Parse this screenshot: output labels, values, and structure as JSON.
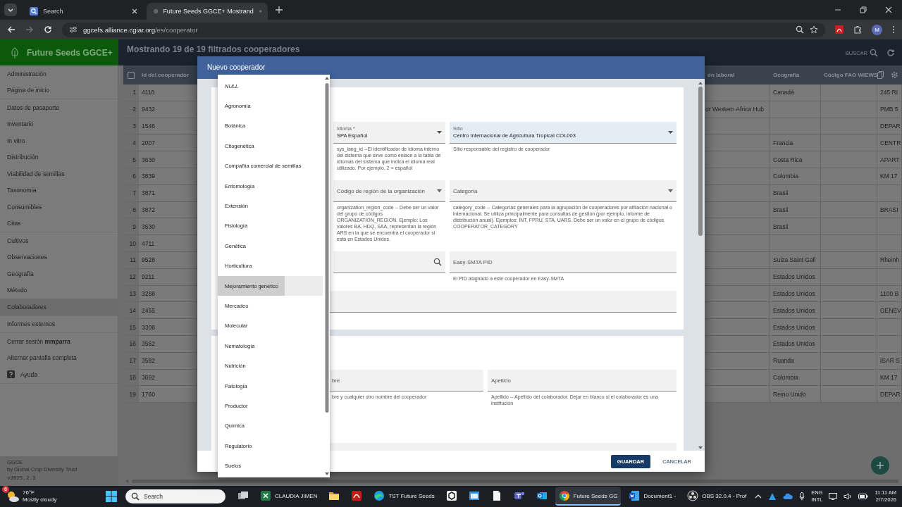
{
  "browser": {
    "tabs": [
      {
        "title": "Search",
        "selected": false
      },
      {
        "title": "Future Seeds GGCE+ Mostrand",
        "selected": true
      }
    ],
    "address": {
      "host": "ggcefs.alliance.cgiar.org",
      "path": "/es/cooperator"
    },
    "profile": "M"
  },
  "app": {
    "brand": "Future Seeds GGCE+",
    "heading": "Mostrando 19 de 19 filtrados cooperadores",
    "search_button": "BUSCAR"
  },
  "sidebar": {
    "groups": [
      [
        {
          "label": "Administración",
          "kind": "link",
          "selected": false
        },
        {
          "label": "Página de inicio",
          "kind": "link",
          "selected": false
        }
      ],
      [
        {
          "label": "Datos de pasaporte",
          "kind": "link",
          "selected": false
        },
        {
          "label": "Inventario",
          "kind": "link",
          "selected": false
        },
        {
          "label": "In vitro",
          "kind": "link",
          "selected": false
        },
        {
          "label": "Distribución",
          "kind": "link",
          "selected": false
        },
        {
          "label": "Viabilidad de semillas",
          "kind": "link",
          "selected": false
        },
        {
          "label": "Taxonomía",
          "kind": "link",
          "selected": false
        },
        {
          "label": "Consumibles",
          "kind": "link",
          "selected": false
        },
        {
          "label": "Citas",
          "kind": "link",
          "selected": false
        }
      ],
      [
        {
          "label": "Cultivos",
          "kind": "link",
          "selected": false
        },
        {
          "label": "Observaciones",
          "kind": "link",
          "selected": false
        },
        {
          "label": "Geografía",
          "kind": "link",
          "selected": false
        },
        {
          "label": "Método",
          "kind": "link",
          "selected": false
        },
        {
          "label": "Colaboradores",
          "kind": "link",
          "selected": true
        }
      ],
      [
        {
          "label": "Informes externos",
          "kind": "link",
          "selected": false
        }
      ],
      [
        {
          "label": "Cerrar sesión **mmparra**",
          "kind": "link",
          "selected": false
        },
        {
          "label": "Alternar pantalla completa",
          "kind": "link",
          "selected": false
        },
        {
          "label": "Ayuda",
          "kind": "help",
          "selected": false
        }
      ]
    ],
    "footer": {
      "product": "GGCE",
      "publisher": "by Global Crop Diversity Trust",
      "version": "v2025.2.3"
    }
  },
  "table": {
    "select_all": {
      "checked": false
    },
    "columns": [
      "Id del cooperador",
      "ón laboral",
      "Geografía",
      "Código FAO WIEWS"
    ],
    "rows": [
      {
        "number": "1",
        "id": "4118",
        "geography": "Canadá",
        "column_7": "245 RI"
      },
      {
        "number": "2",
        "id": "9432",
        "column_4": "or Western Africa Hub",
        "column_7": "PMB 5"
      },
      {
        "number": "3",
        "id": "1546",
        "column_7": "DEPAR"
      },
      {
        "number": "4",
        "id": "2007",
        "geography": "Francia",
        "column_7": "CENTR"
      },
      {
        "number": "5",
        "id": "3630",
        "geography": "Costa Rica",
        "column_7": "APART"
      },
      {
        "number": "6",
        "id": "3839",
        "geography": "Colombia",
        "column_7": "KM 17"
      },
      {
        "number": "7",
        "id": "3871",
        "geography": "Brasil"
      },
      {
        "number": "8",
        "id": "3872",
        "geography": "Brasil",
        "column_7": "BRASI"
      },
      {
        "number": "9",
        "id": "3530",
        "geography": "Brasil"
      },
      {
        "number": "10",
        "id": "4711"
      },
      {
        "number": "11",
        "id": "9528",
        "geography": "Suiza Saint Gall",
        "column_7": "Rheinh"
      },
      {
        "number": "12",
        "id": "9211",
        "geography": "Estados Unidos"
      },
      {
        "number": "13",
        "id": "3288",
        "geography": "Estados Unidos",
        "column_7": "1100 B"
      },
      {
        "number": "14",
        "id": "2455",
        "geography": "Estados Unidos",
        "column_7": "GENEV"
      },
      {
        "number": "15",
        "id": "3308",
        "geography": "Estados Unidos"
      },
      {
        "number": "16",
        "id": "3562",
        "geography": "Estados Unidos"
      },
      {
        "number": "17",
        "id": "3582",
        "geography": "Ruanda",
        "column_7": "ISAR S"
      },
      {
        "number": "18",
        "id": "3692",
        "geography": "Colombia",
        "column_7": "KM 17"
      },
      {
        "number": "19",
        "id": "1760",
        "geography": "Reino Unido",
        "column_7": "DEPAR"
      }
    ]
  },
  "modal": {
    "title": "Nuevo cooperador",
    "sections": [
      {
        "rows": [
          [
            {
              "kind": "select",
              "label": "Idioma *",
              "value": "SPA Español",
              "focused": false,
              "helper": "sys_lang_id --El identificador de idioma interno del sistema que sirve como enlace a la tabla de idiomas del sistema que indica el idioma real utilizado. Por ejemplo, 2 = español"
            },
            {
              "kind": "select",
              "label": "Sitio",
              "value": "Centro Internacional de Agricultura Tropical COL003",
              "focused": true,
              "helper": "Sitio responsable del registro de cooperador"
            }
          ],
          [
            {
              "kind": "select",
              "placeholder": "Código de región de la organización",
              "focused": false,
              "helper": "organization_region_code -- Debe ser un valor del grupo de códigos ORGANIZATION_REGION. Ejemplo: Los valores BA, HDQ, SAA, representan la región ARS en la que se encuentra el cooperador si está en Estados Unidos."
            },
            {
              "kind": "select",
              "placeholder": "Categoría",
              "focused": false,
              "helper": "category_code -- Categorías generales para la agrupación de cooperadores por afiliación nacional o internacional. Se utiliza principalmente para consultas de gestión (por ejemplo, informe de distribución anual). Ejemplos: INT, FPRU, STA, UARS. Debe ser un valor en el grupo de códigos COOPERATOR_CATEGORY"
            }
          ],
          [
            {
              "kind": "search",
              "focused": false
            },
            {
              "kind": "text",
              "placeholder": "Easy-SMTA PID",
              "focused": false,
              "helper": "El PID asignado a este cooperador en Easy-SMTA"
            }
          ],
          [
            {
              "kind": "text",
              "focused": false
            }
          ]
        ]
      },
      {
        "rows": [
          [
            {
              "kind": "text",
              "placeholder": "bre",
              "focused": false,
              "helper": "bre y cualquier otro nombre del cooperador"
            },
            {
              "kind": "text",
              "placeholder": "Apellido",
              "focused": false,
              "helper": "Apellido -- Apellido del colaborador. Dejar en blanco si el colaborador es una institución"
            }
          ],
          [
            {
              "kind": "text",
              "focused": false
            }
          ]
        ]
      }
    ],
    "buttons": [
      {
        "label": "GUARDAR",
        "kind": "primary"
      },
      {
        "label": "CANCELAR",
        "kind": "text"
      }
    ]
  },
  "dropdown": {
    "options": [
      {
        "label": "NULL",
        "kind": "null",
        "selected": false
      },
      {
        "label": "Agronomía",
        "kind": "option",
        "selected": false
      },
      {
        "label": "Botánica",
        "kind": "option",
        "selected": false
      },
      {
        "label": "Citogenética",
        "kind": "option",
        "selected": false
      },
      {
        "label": "Compañía comercial de semillas",
        "kind": "option",
        "selected": false
      },
      {
        "label": "Entomología",
        "kind": "option",
        "selected": false
      },
      {
        "label": "Extensión",
        "kind": "option",
        "selected": false
      },
      {
        "label": "Fisiología",
        "kind": "option",
        "selected": false
      },
      {
        "label": "Genética",
        "kind": "option",
        "selected": false
      },
      {
        "label": "Horticultura",
        "kind": "option",
        "selected": false
      },
      {
        "label": "Mejoramiento genético",
        "kind": "option",
        "selected": true
      },
      {
        "label": "Mercadeo",
        "kind": "option",
        "selected": false
      },
      {
        "label": "Molecular",
        "kind": "option",
        "selected": false
      },
      {
        "label": "Nematología",
        "kind": "option",
        "selected": false
      },
      {
        "label": "Nutrición",
        "kind": "option",
        "selected": false
      },
      {
        "label": "Patología",
        "kind": "option",
        "selected": false
      },
      {
        "label": "Productor",
        "kind": "option",
        "selected": false
      },
      {
        "label": "Química",
        "kind": "option",
        "selected": false
      },
      {
        "label": "Regulatorio",
        "kind": "option",
        "selected": false
      },
      {
        "label": "Suelos",
        "kind": "option",
        "selected": false
      }
    ]
  },
  "taskbar": {
    "weather": {
      "badge": "6",
      "temperature": "76°F",
      "condition": "Mostly cloudy"
    },
    "search_placeholder": "Search",
    "apps": [
      {
        "kind": "taskview",
        "active": false
      },
      {
        "kind": "spreadsheet",
        "label": "CLAUDIA JIMEN",
        "active": false
      },
      {
        "kind": "folder",
        "active": false
      },
      {
        "kind": "pdf",
        "active": false
      },
      {
        "kind": "edge",
        "label": "TST Future Seeds",
        "active": false
      },
      {
        "kind": "app",
        "active": false
      },
      {
        "kind": "window",
        "active": false
      },
      {
        "kind": "file",
        "active": false
      },
      {
        "kind": "teams",
        "active": false
      },
      {
        "kind": "outlook",
        "active": false
      },
      {
        "kind": "chrome",
        "label": "Future Seeds GG",
        "active": true
      },
      {
        "kind": "word",
        "label": "Document1 -",
        "active": false
      },
      {
        "kind": "obs",
        "label": "OBS 32.0.4 - Prof",
        "active": false
      }
    ],
    "language": [
      "ENG",
      "INTL"
    ],
    "time": "11:11 AM",
    "date": "2/7/2026"
  }
}
